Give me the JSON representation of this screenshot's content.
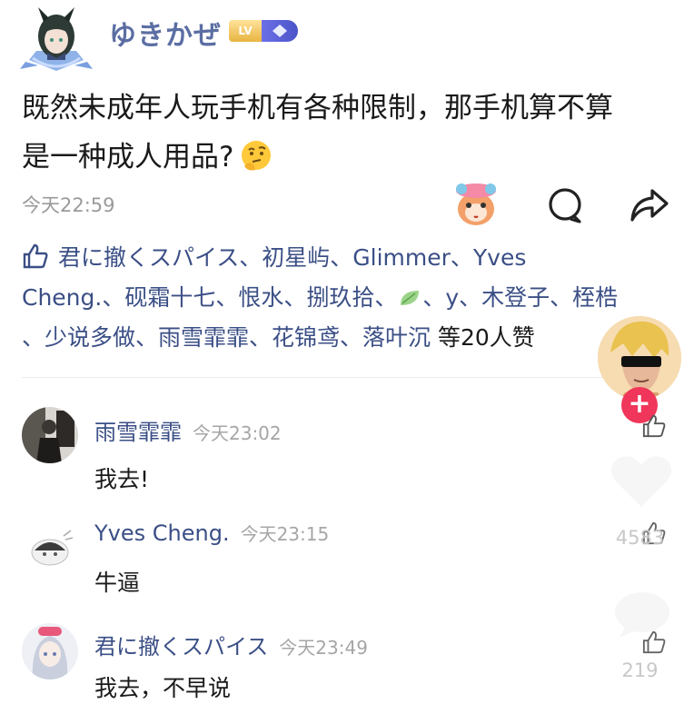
{
  "post": {
    "author": "ゆきかぜ",
    "level_badge": "LV",
    "text_line1": "既然未成年人玩手机有各种限制，那手机算不算",
    "text_line2": "是一种成人用品?",
    "time": "今天22:59"
  },
  "likes": {
    "line1": "君に撤くスパイス、初星屿、Glimmer、Yves",
    "line2": "Cheng.、砚霜十七、恨水、捌玖拾、",
    "line2b": "、y、木登子、桎梏",
    "line3": "、少说多做、雨雪霏霏、花锦鸢、落叶沉",
    "line3_tail": "等20人赞"
  },
  "comments": [
    {
      "name": "雨雪霏霏",
      "time": "今天23:02",
      "text": "我去!"
    },
    {
      "name": "Yves Cheng.",
      "time": "今天23:15",
      "text": "牛逼"
    },
    {
      "name": "君に撤くスパイス",
      "time": "今天23:49",
      "text": "我去，不早说"
    }
  ],
  "overlay": {
    "like_count": "4583",
    "comment_count": "219",
    "follow_symbol": "+"
  },
  "colors": {
    "name_blue": "#3b4f86",
    "follow_red": "#f0365a",
    "time_gray": "#9a9a9a"
  }
}
